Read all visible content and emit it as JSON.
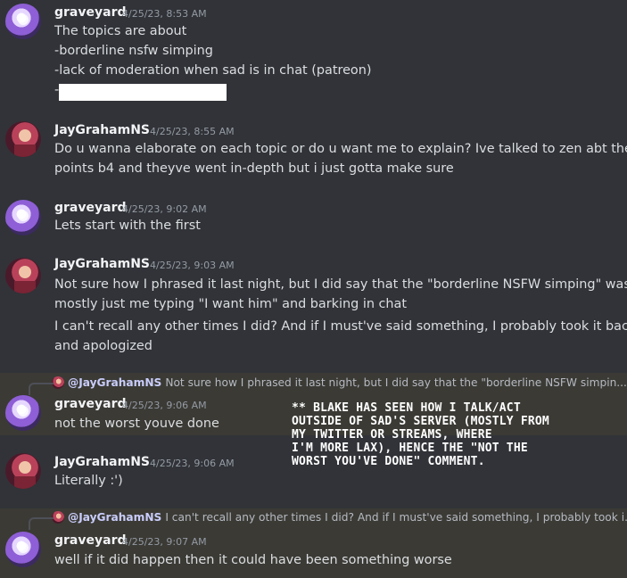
{
  "users": {
    "graveyard": "graveyard",
    "jay": "JayGrahamNS"
  },
  "messages": [
    {
      "author": "graveyard",
      "time": "4/25/23, 8:53 AM",
      "lines": [
        "The topics are about",
        "-borderline nsfw simping",
        "-lack of moderation when sad is in chat (patreon)",
        "-"
      ]
    },
    {
      "author": "JayGrahamNS",
      "time": "4/25/23, 8:55 AM",
      "lines": [
        "Do u wanna elaborate on each topic or do u want me to explain? Ive talked to zen abt these",
        "points b4 and theyve went in-depth but i just gotta make sure"
      ]
    },
    {
      "author": "graveyard",
      "time": "4/25/23, 9:02 AM",
      "lines": [
        "Lets start with the first"
      ]
    },
    {
      "author": "JayGrahamNS",
      "time": "4/25/23, 9:03 AM",
      "lines": [
        "Not sure how I phrased it last night, but I did say that the \"borderline NSFW simping\" was",
        "mostly just me typing \"I want him\" and barking in chat",
        "I can't recall any other times I did? And if I must've said something, I probably took it back",
        "and apologized"
      ]
    },
    {
      "reply_to": "@JayGrahamNS",
      "reply_preview": "Not sure how I phrased it last night, but I did say that the \"borderline NSFW simpin...",
      "author": "graveyard",
      "time": "4/25/23, 9:06 AM",
      "lines": [
        "not the worst youve done"
      ]
    },
    {
      "author": "JayGrahamNS",
      "time": "4/25/23, 9:06 AM",
      "lines": [
        "Literally :')"
      ]
    },
    {
      "reply_to": "@JayGrahamNS",
      "reply_preview": "I can't recall any other times I did? And if I must've said something, I probably took i...",
      "author": "graveyard",
      "time": "4/25/23, 9:07 AM",
      "lines": [
        "well if it did happen then it could have been something worse"
      ]
    }
  ],
  "annotation": [
    "** Blake has seen how I talk/act",
    "outside of sad's server (mostly from",
    "my twitter or streams, where",
    "I'm more lax), hence the \"not the",
    "worst you've done\" comment."
  ]
}
